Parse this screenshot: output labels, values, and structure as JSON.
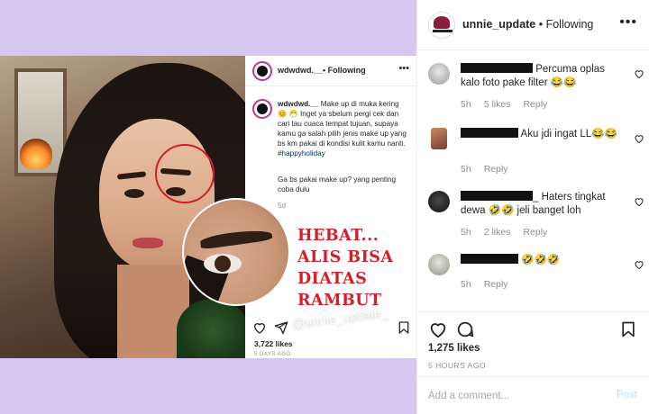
{
  "media": {
    "card": {
      "username": "wdwdwd.__",
      "following": "• Following",
      "caption_user": "wdwdwd.__",
      "caption_text": " Make up di muka kering 😊 😷  Inget ya sbelum pergi cek dan cari tau cuaca tempat tujuan, supaya kamu ga salah pilih jenis make up yang bs km pakai di kondisi kulit kamu nanti. ",
      "hashtag": "#happyholiday",
      "caption_text2": "Ga bs pakai make up? yang penting coba dulu",
      "time": "5d",
      "likes": "3,722 likes",
      "ago": "5 DAYS AGO"
    },
    "overlay_text": [
      "HEBAT...",
      "ALIS BISA",
      "DIATAS",
      "RAMBUT"
    ],
    "watermark": "@unnie_update_"
  },
  "panel": {
    "username": "unnie_update",
    "following": " • Following",
    "comments": [
      {
        "text": " Percuma oplas kalo foto pake filter 😂😂",
        "time": "5h",
        "likes": "5 likes",
        "reply": "Reply"
      },
      {
        "text": " Aku jdi ingat LL😂😂",
        "time": "5h",
        "likes": "",
        "reply": "Reply"
      },
      {
        "text": "_ Haters tingkat dewa 🤣🤣 jeli banget loh",
        "time": "5h",
        "likes": "2 likes",
        "reply": "Reply"
      },
      {
        "text": " 🤣🤣🤣",
        "time": "5h",
        "likes": "",
        "reply": "Reply"
      }
    ],
    "likes": "1,275 likes",
    "ago": "5 HOURS AGO",
    "add_comment_placeholder": "Add a comment...",
    "post_label": "Post"
  },
  "colors": {
    "bg_lavender": "#d7c6ef",
    "overlay_red": "#d41f2a",
    "post_disabled": "#b2dffc",
    "muted": "#8e8e8e"
  }
}
